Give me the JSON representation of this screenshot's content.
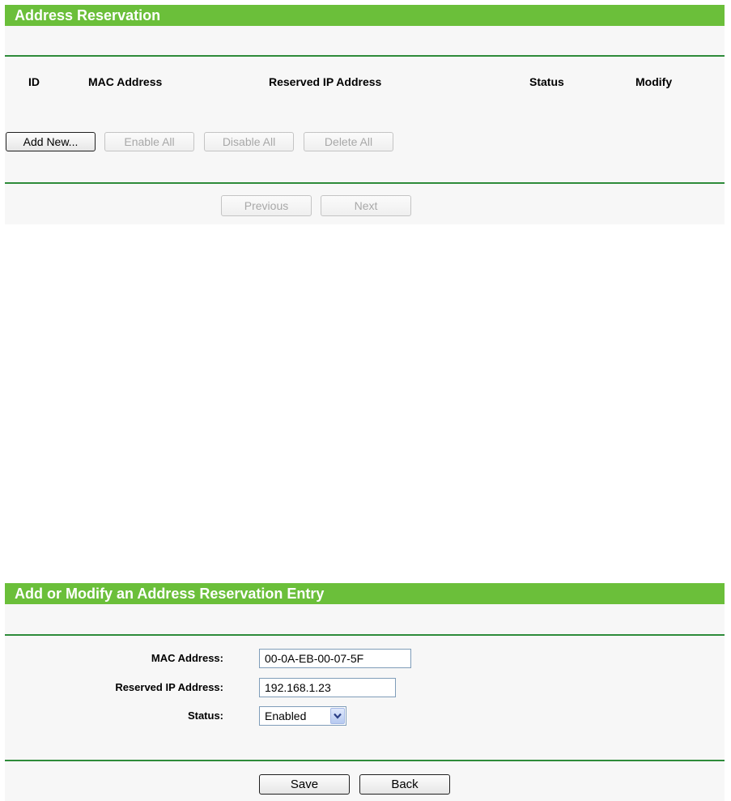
{
  "reservation": {
    "title": "Address Reservation",
    "columns": {
      "id": "ID",
      "mac": "MAC Address",
      "reserved_ip": "Reserved IP Address",
      "status": "Status",
      "modify": "Modify"
    },
    "buttons": {
      "add_new": "Add New...",
      "enable_all": "Enable All",
      "disable_all": "Disable All",
      "delete_all": "Delete All"
    },
    "pagination": {
      "previous": "Previous",
      "next": "Next"
    }
  },
  "entry": {
    "title": "Add or Modify an Address Reservation Entry",
    "mac_label": "MAC Address:",
    "mac_value": "00-0A-EB-00-07-5F",
    "ip_label": "Reserved IP Address:",
    "ip_value": "192.168.1.23",
    "status_label": "Status:",
    "status_value": "Enabled",
    "save": "Save",
    "back": "Back"
  },
  "colors": {
    "header_green": "#6bbf3a",
    "rule_green": "#2e8b3a"
  }
}
